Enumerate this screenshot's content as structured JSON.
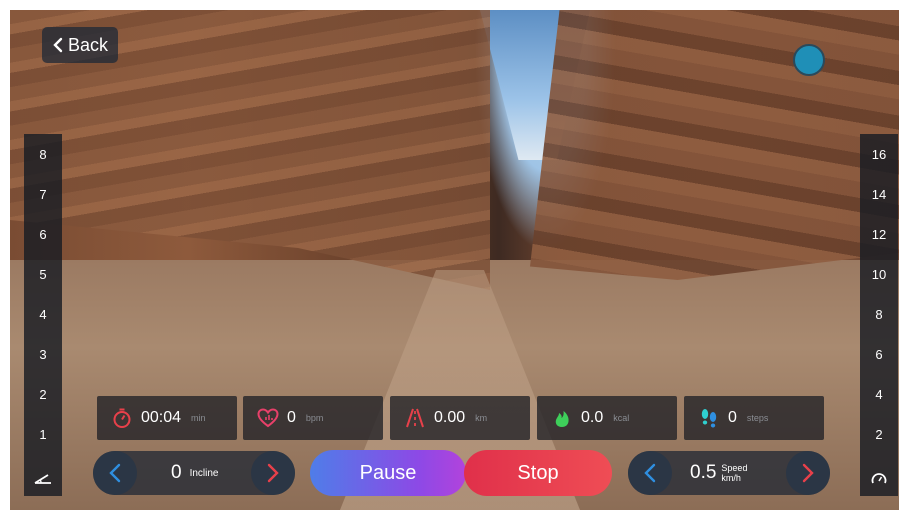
{
  "nav": {
    "back_label": "Back"
  },
  "incline_scale": {
    "ticks": [
      "8",
      "7",
      "6",
      "5",
      "4",
      "3",
      "2",
      "1"
    ],
    "icon": "incline-icon"
  },
  "speed_scale": {
    "ticks": [
      "16",
      "14",
      "12",
      "10",
      "8",
      "6",
      "4",
      "2"
    ],
    "icon": "speedometer-icon"
  },
  "stats": {
    "time": {
      "value": "00:04",
      "unit": "min",
      "icon": "stopwatch-icon",
      "color": "#e8404a"
    },
    "heart": {
      "value": "0",
      "unit": "bpm",
      "icon": "heart-rate-icon",
      "color": "#e8406a"
    },
    "distance": {
      "value": "0.00",
      "unit": "km",
      "icon": "road-icon",
      "color": "#e8404a"
    },
    "calories": {
      "value": "0.0",
      "unit": "kcal",
      "icon": "flame-icon",
      "color": "#3ecf5a"
    },
    "steps": {
      "value": "0",
      "unit": "steps",
      "icon": "footprints-icon",
      "color": "#2fd0d0"
    }
  },
  "controls": {
    "incline": {
      "value": "0",
      "label": "Incline"
    },
    "speed": {
      "value": "0.5",
      "label": "Speed",
      "unit": "km/h"
    },
    "pause_label": "Pause",
    "stop_label": "Stop"
  },
  "colors": {
    "accent_blue": "#2f8fe0",
    "accent_red": "#e8404a",
    "record": "#1f8fb7"
  }
}
